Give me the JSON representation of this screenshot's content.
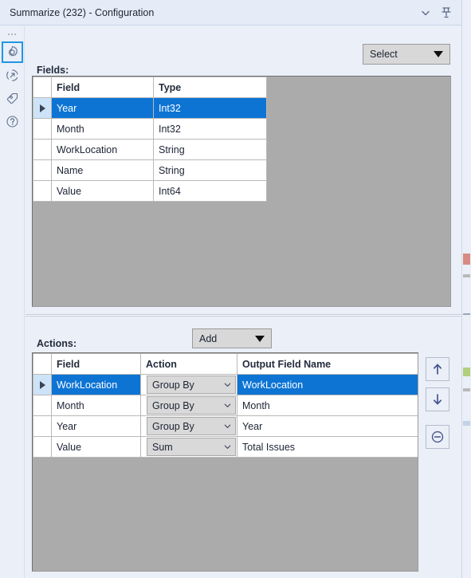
{
  "window": {
    "title": "Summarize (232) - Configuration",
    "collapse_icon": "chevron-down-icon",
    "pin_icon": "pin-icon"
  },
  "rail": {
    "overflow_indicator": "…",
    "items": [
      {
        "icon": "gear-icon",
        "name": "configuration",
        "selected": true
      },
      {
        "icon": "arrow-in-circle-icon",
        "name": "output",
        "selected": false
      },
      {
        "icon": "tag-icon",
        "name": "annotation",
        "selected": false
      },
      {
        "icon": "question-circle-icon",
        "name": "help",
        "selected": false
      }
    ]
  },
  "fields_section": {
    "label": "Fields:",
    "select_dropdown": {
      "label": "Select",
      "caret_icon": "caret-down-icon"
    },
    "columns": [
      "",
      "Field",
      "Type"
    ],
    "rows": [
      {
        "field": "Year",
        "type": "Int32",
        "selected": true
      },
      {
        "field": "Month",
        "type": "Int32",
        "selected": false
      },
      {
        "field": "WorkLocation",
        "type": "String",
        "selected": false
      },
      {
        "field": "Name",
        "type": "String",
        "selected": false
      },
      {
        "field": "Value",
        "type": "Int64",
        "selected": false
      }
    ]
  },
  "actions_section": {
    "label": "Actions:",
    "add_dropdown": {
      "label": "Add",
      "caret_icon": "caret-down-icon"
    },
    "columns": [
      "",
      "Field",
      "Action",
      "Output Field Name"
    ],
    "rows": [
      {
        "field": "WorkLocation",
        "action": "Group By",
        "output": "WorkLocation",
        "selected": true
      },
      {
        "field": "Month",
        "action": "Group By",
        "output": "Month",
        "selected": false
      },
      {
        "field": "Year",
        "action": "Group By",
        "output": "Year",
        "selected": false
      },
      {
        "field": "Value",
        "action": "Sum",
        "output": "Total Issues",
        "selected": false
      }
    ],
    "buttons": [
      {
        "name": "move-up-button",
        "icon": "arrow-up-icon"
      },
      {
        "name": "move-down-button",
        "icon": "arrow-down-icon"
      },
      {
        "name": "remove-button",
        "icon": "minus-circle-icon"
      }
    ]
  },
  "colors": {
    "selection_blue": "#0d74d4",
    "selection_row_indicator": "#cde3f7",
    "panel_gray": "#ababab",
    "window_bg": "#eaeff8",
    "accent_focus": "#2196e3"
  }
}
